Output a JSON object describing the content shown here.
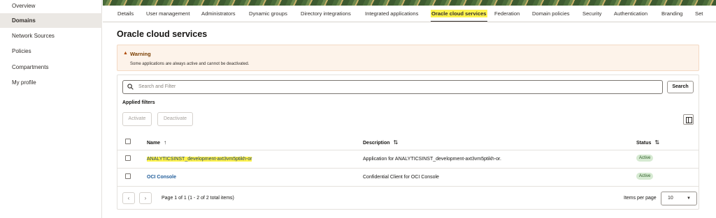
{
  "sidebar": {
    "items": [
      {
        "label": "Overview"
      },
      {
        "label": "Domains"
      },
      {
        "label": "Network Sources"
      },
      {
        "label": "Policies"
      },
      {
        "label": "Compartments"
      },
      {
        "label": "My profile"
      }
    ]
  },
  "tabs": [
    {
      "label": "Details"
    },
    {
      "label": "User management"
    },
    {
      "label": "Administrators"
    },
    {
      "label": "Dynamic groups"
    },
    {
      "label": "Directory integrations"
    },
    {
      "label": "Integrated applications"
    },
    {
      "label": "Oracle cloud services"
    },
    {
      "label": "Federation"
    },
    {
      "label": "Domain policies"
    },
    {
      "label": "Security"
    },
    {
      "label": "Authentication"
    },
    {
      "label": "Branding"
    },
    {
      "label": "Set"
    }
  ],
  "page": {
    "title": "Oracle cloud services"
  },
  "warning": {
    "icon": "warning-triangle-icon",
    "title": "Warning",
    "message": "Some applications are always active and cannot be deactivated."
  },
  "search": {
    "placeholder": "Search and Filter",
    "button": "Search"
  },
  "filters": {
    "title": "Applied filters",
    "activate": "Activate",
    "deactivate": "Deactivate"
  },
  "table": {
    "headers": {
      "name": "Name",
      "description": "Description",
      "status": "Status"
    },
    "sort_icons": {
      "name": "↑",
      "description": "⇅",
      "status": "⇅"
    },
    "rows": [
      {
        "name": "ANALYTICSINST_development-axt3vm5ptikh-or",
        "description": "Application for ANALYTICSINST_development-axt3vm5ptikh-or.",
        "status": "Active"
      },
      {
        "name": "OCI Console",
        "description": "Confidential Client for OCI Console",
        "status": "Active"
      }
    ]
  },
  "pagination": {
    "prev_icon": "‹",
    "next_icon": "›",
    "text": "Page 1 of 1 (1 - 2 of 2 total items)",
    "items_per_page_label": "Items per page",
    "items_per_page_value": "10",
    "caret": "▼"
  },
  "colors": {
    "accent_highlight": "#fff34d",
    "link": "#1f5c99",
    "active_badge": "#d6ead2"
  }
}
